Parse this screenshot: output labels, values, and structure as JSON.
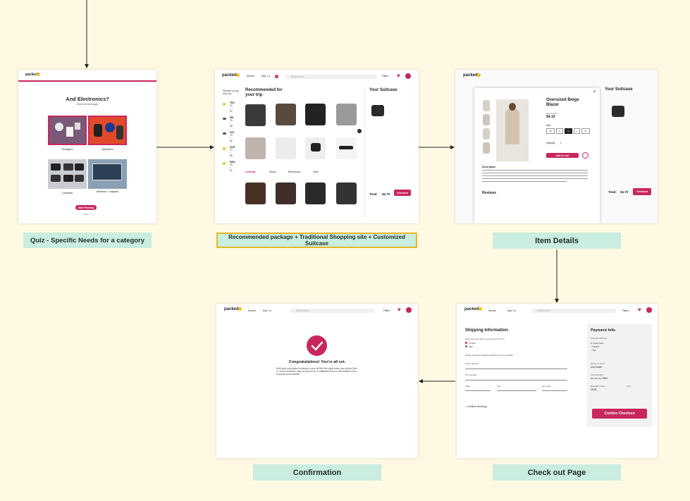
{
  "labels": {
    "quiz": "Quiz - Specific Needs for a category",
    "recommended": "Recommended package + Traditional Shopping site + Customized Suitcase",
    "item_details": "Item Details",
    "confirmation": "Confirmation",
    "checkout": "Check out Page"
  },
  "quiz": {
    "logo": "packed",
    "title": "And Electronics?",
    "subtitle": "Select all that apply",
    "options": [
      "Chargers",
      "Speakers",
      "Cameras",
      "Monitors / Laptops"
    ],
    "cta": "Start Packing",
    "skip": "Skip"
  },
  "rec": {
    "logo": "packed",
    "nav_city": "Denver",
    "nav_dates": "Sep 1-4",
    "nav_badge": "3",
    "search_placeholder": "Search item...",
    "filters": "Filters",
    "weather_title": "Weather during your trip",
    "weather": [
      {
        "day": "THU",
        "temp": "70 / 57"
      },
      {
        "day": "FRI",
        "temp": "75 / 55"
      },
      {
        "day": "SAT",
        "temp": "72 / 52"
      },
      {
        "day": "SUN",
        "temp": "77 / 56"
      },
      {
        "day": "MON",
        "temp": "75 / 57"
      }
    ],
    "heading": "Recommended for your trip",
    "tabs": [
      "Clothing",
      "Shoes",
      "Electronics",
      "Gear"
    ],
    "suitcase_title": "Your Suitcase",
    "total_label": "Total:",
    "total_value": "$4.70",
    "checkout_btn": "Checkout"
  },
  "item": {
    "product_name": "Oversized Beige Blazer",
    "rent_for": "Rent for 3/4",
    "price": "$4.10",
    "size_label": "Size",
    "sizes": [
      "XS",
      "S",
      "M",
      "L",
      "XL"
    ],
    "quantity_label": "Quantity",
    "quantity": "1",
    "add_btn": "Add to Cart",
    "description_label": "Description",
    "reviews_label": "Reviews",
    "suitcase_title": "Your Suitcase",
    "total_label": "Total:",
    "total_value": "$4.70",
    "checkout_btn": "Checkout"
  },
  "checkout": {
    "logo": "packed",
    "nav_city": "Denver",
    "nav_dates": "Sep 1-4",
    "search_placeholder": "Search item...",
    "filters": "Filters",
    "shipping_title": "Shipping Information.",
    "question": "How would you like to receive your items?",
    "options": [
      "In store",
      "Mail"
    ],
    "note": "Please enter the shipping address for your suitcase",
    "fields": [
      "Street address",
      "Unit Number",
      "State",
      "City",
      "Zip Code"
    ],
    "continue": "< Continue Browsing",
    "payment_title": "Payment Info.",
    "payment_method_label": "Payment Method",
    "payment_methods": [
      "Credit Card",
      "PayPal",
      "Pay"
    ],
    "name_on_card_label": "Name on Card",
    "name_on_card": "Ava Golder",
    "card_number_label": "Card Number",
    "card_number": "•••• •••• •••• 3356",
    "exp_label": "Expiration Date",
    "exp": "05/25",
    "cvv_label": "CVV",
    "confirm_btn": "Confirm Checkout"
  },
  "confirm": {
    "logo": "packed",
    "nav_city": "Denver",
    "nav_dates": "Sep 1-4",
    "search_placeholder": "Search item...",
    "filters": "Filters",
    "title": "Congratulations! You're all set.",
    "body": "We'll pack your packed suitcase to your air BnB the night before your arrival (Sep 1). In the meantime, keep an eye out for a notification from us with details of how to access your suitcase."
  },
  "colors": {
    "background": "#fff9e3",
    "label_bg": "#c9eddf",
    "accent": "#c8265c",
    "highlight_border": "#e5b829"
  }
}
